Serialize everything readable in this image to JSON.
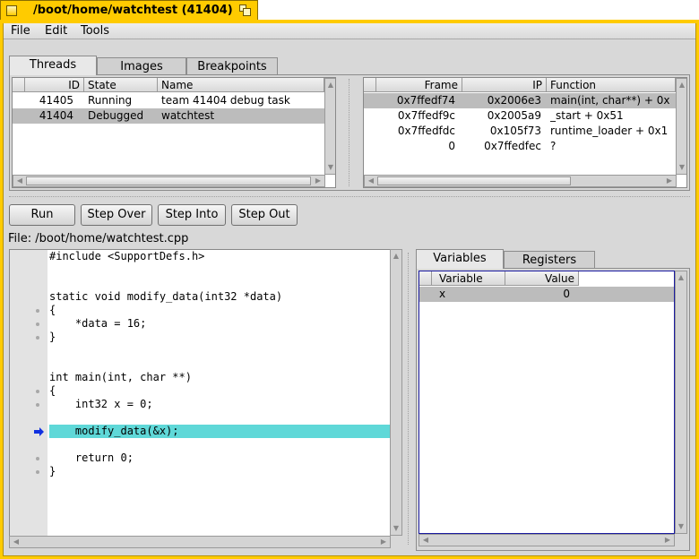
{
  "window": {
    "title": "/boot/home/watchtest (41404)"
  },
  "menubar": {
    "items": [
      "File",
      "Edit",
      "Tools"
    ]
  },
  "top_tabs": [
    "Threads",
    "Images",
    "Breakpoints"
  ],
  "threads": {
    "columns": [
      "ID",
      "State",
      "Name"
    ],
    "rows": [
      {
        "id": "41405",
        "state": "Running",
        "name": "team 41404 debug task"
      },
      {
        "id": "41404",
        "state": "Debugged",
        "name": "watchtest"
      }
    ]
  },
  "stack": {
    "columns": [
      "Frame",
      "IP",
      "Function"
    ],
    "rows": [
      {
        "frame": "0x7ffedf74",
        "ip": "0x2006e3",
        "function": "main(int, char**) + 0x"
      },
      {
        "frame": "0x7ffedf9c",
        "ip": "0x2005a9",
        "function": "_start + 0x51"
      },
      {
        "frame": "0x7ffedfdc",
        "ip": "0x105f73",
        "function": "runtime_loader + 0x1"
      },
      {
        "frame": "0",
        "ip": "0x7ffedfec",
        "function": "?"
      }
    ]
  },
  "toolbar": {
    "run": "Run",
    "step_over": "Step Over",
    "step_into": "Step Into",
    "step_out": "Step Out"
  },
  "file_label": "File: /boot/home/watchtest.cpp",
  "source": {
    "lines": [
      "#include <SupportDefs.h>",
      "",
      "",
      "static void modify_data(int32 *data)",
      "{",
      "    *data = 16;",
      "}",
      "",
      "",
      "int main(int, char **)",
      "{",
      "    int32 x = 0;",
      "",
      "    modify_data(&x);",
      "",
      "    return 0;",
      "}"
    ]
  },
  "var_tabs": [
    "Variables",
    "Registers"
  ],
  "variables": {
    "columns": [
      "Variable",
      "Value"
    ],
    "rows": [
      {
        "name": "x",
        "value": "0"
      }
    ]
  },
  "colors": {
    "window_tab": "#ffcb00",
    "current_line": "#5fd8d8",
    "selection": "#bcbcbc",
    "variables_border": "#1a1aa0"
  }
}
